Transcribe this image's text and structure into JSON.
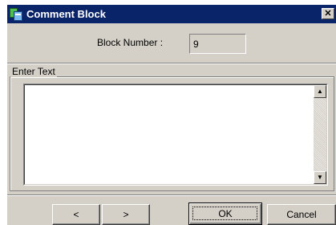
{
  "window": {
    "title": "Comment Block",
    "close_glyph": "✕"
  },
  "block": {
    "label": "Block Number :",
    "value": "9"
  },
  "group": {
    "label": "Enter Text",
    "text": ""
  },
  "scrollbar": {
    "up_glyph": "▲",
    "down_glyph": "▼"
  },
  "buttons": {
    "prev": "<",
    "next": ">",
    "ok": "OK",
    "cancel": "Cancel"
  },
  "icons": {
    "app": "comment-block-app-icon",
    "close": "close-icon",
    "up": "scroll-up-arrow-icon",
    "down": "scroll-down-arrow-icon"
  }
}
